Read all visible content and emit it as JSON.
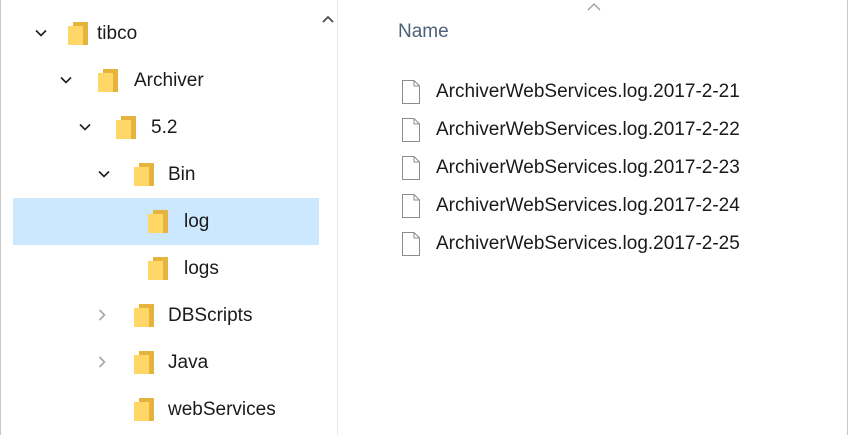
{
  "nav": {
    "items": [
      {
        "label": "tibco",
        "expander": "expanded",
        "selected": false
      },
      {
        "label": "Archiver",
        "expander": "expanded",
        "selected": false
      },
      {
        "label": "5.2",
        "expander": "expanded",
        "selected": false
      },
      {
        "label": "Bin",
        "expander": "expanded",
        "selected": false
      },
      {
        "label": "log",
        "expander": "none",
        "selected": true
      },
      {
        "label": "logs",
        "expander": "none",
        "selected": false
      },
      {
        "label": "DBScripts",
        "expander": "collapsed",
        "selected": false
      },
      {
        "label": "Java",
        "expander": "collapsed",
        "selected": false
      },
      {
        "label": "webServices",
        "expander": "none",
        "selected": false
      }
    ]
  },
  "content": {
    "column_header": "Name",
    "files": [
      {
        "name": "ArchiverWebServices.log.2017-2-21"
      },
      {
        "name": "ArchiverWebServices.log.2017-2-22"
      },
      {
        "name": "ArchiverWebServices.log.2017-2-23"
      },
      {
        "name": "ArchiverWebServices.log.2017-2-24"
      },
      {
        "name": "ArchiverWebServices.log.2017-2-25"
      }
    ]
  },
  "colors": {
    "selection": "#cce8ff",
    "folder_back": "#e6b33d",
    "folder_front": "#ffd766",
    "header_text": "#4c607a"
  },
  "icons": {
    "folder": "folder-icon",
    "file": "file-icon",
    "expanded": "chevron-down-icon",
    "collapsed": "chevron-right-icon"
  }
}
